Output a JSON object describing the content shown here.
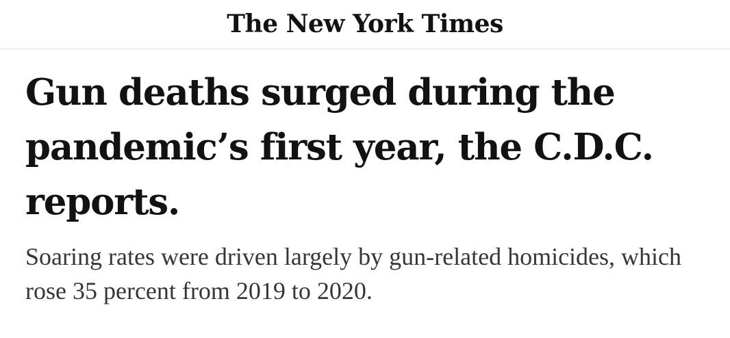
{
  "masthead": {
    "logo_text": "The New York Times"
  },
  "article": {
    "headline": "Gun deaths surged during the pandemic’s first year, the C.D.C. reports.",
    "summary": "Soaring rates were driven largely by gun-related homicides, which rose 35 percent from 2019 to 2020."
  }
}
